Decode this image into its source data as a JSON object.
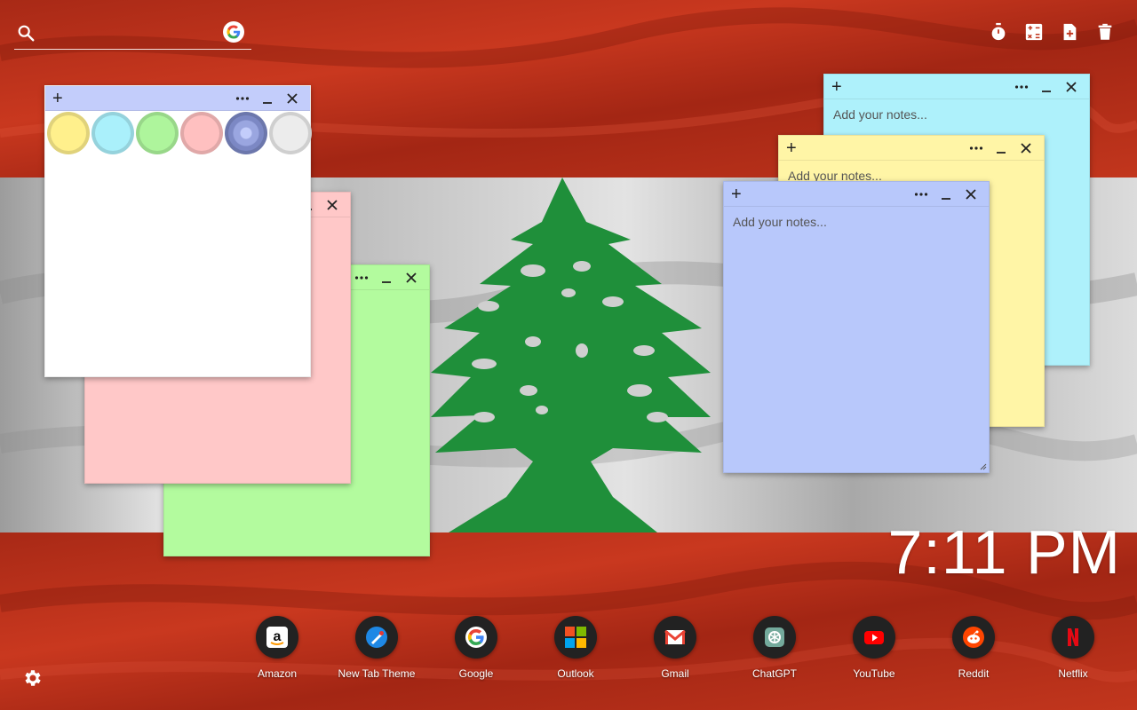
{
  "search": {
    "placeholder": ""
  },
  "toolbar": {
    "icons": [
      "timer-icon",
      "calculator-icon",
      "add-note-icon",
      "delete-icon"
    ]
  },
  "notes": {
    "placeholder": "Add your notes...",
    "white": {
      "color": "#ffffff",
      "header_color": "#c3cdfb"
    },
    "pink": {
      "color": "#ffc8c8"
    },
    "green": {
      "color": "#b3fb9e"
    },
    "cyan": {
      "color": "#aef1fb"
    },
    "yellow": {
      "color": "#fff5a6"
    },
    "blue": {
      "color": "#b8c8fb"
    },
    "swatches": [
      "#fff08c",
      "#aaf0fb",
      "#aef59c",
      "#ffc0c0",
      "#8c98cf",
      "#ececec"
    ]
  },
  "clock": {
    "time": "7:11 PM"
  },
  "shortcuts": [
    {
      "label": "Amazon",
      "icon": "amazon-icon"
    },
    {
      "label": "New Tab Theme",
      "icon": "new-tab-theme-icon"
    },
    {
      "label": "Google",
      "icon": "google-icon"
    },
    {
      "label": "Outlook",
      "icon": "outlook-icon"
    },
    {
      "label": "Gmail",
      "icon": "gmail-icon"
    },
    {
      "label": "ChatGPT",
      "icon": "chatgpt-icon"
    },
    {
      "label": "YouTube",
      "icon": "youtube-icon"
    },
    {
      "label": "Reddit",
      "icon": "reddit-icon"
    },
    {
      "label": "Netflix",
      "icon": "netflix-icon"
    }
  ],
  "colors": {
    "flag_red": "#c0341c",
    "flag_white": "#d8d8d8",
    "cedar_green": "#1f8f3a"
  }
}
